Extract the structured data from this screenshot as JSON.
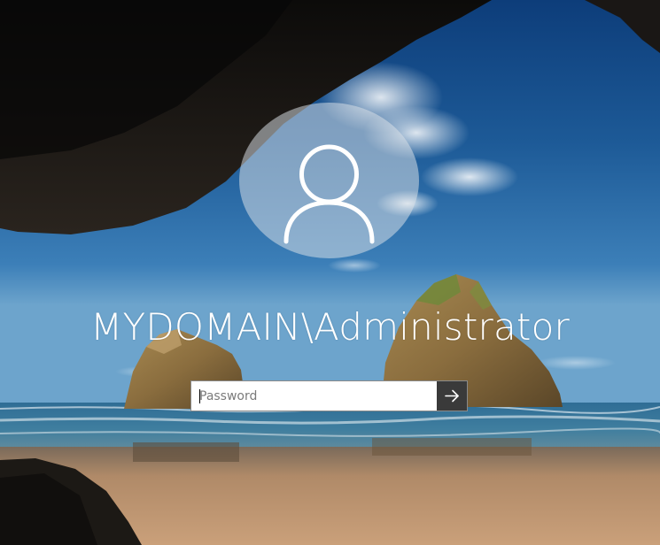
{
  "lock_screen": {
    "username": "MYDOMAIN\\Administrator",
    "password_placeholder": "Password",
    "password_value": ""
  },
  "icons": {
    "avatar": "user-silhouette-icon",
    "submit": "arrow-right-icon"
  },
  "colors": {
    "avatar_circle": "#dce2e8",
    "submit_button": "#3a3a3a",
    "text": "#ffffff"
  }
}
